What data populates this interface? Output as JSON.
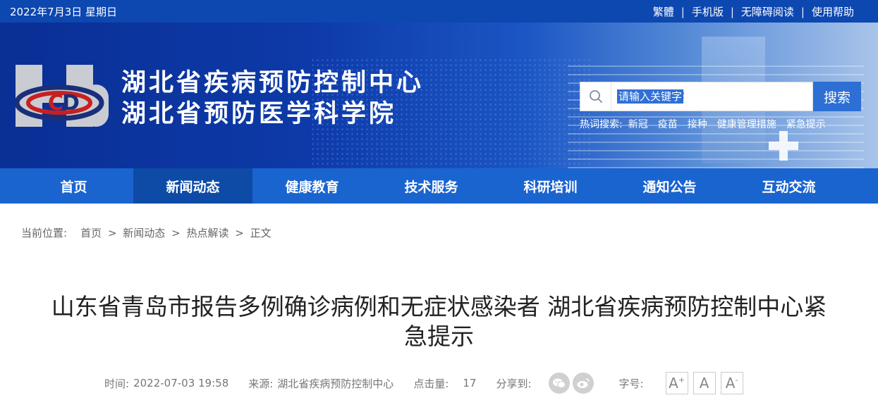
{
  "topbar": {
    "date": "2022年7月3日 星期日",
    "links": [
      "繁體",
      "手机版",
      "无障碍阅读",
      "使用帮助"
    ],
    "separator": "|"
  },
  "header": {
    "title_line1": "湖北省疾病预防控制中心",
    "title_line2": "湖北省预防医学科学院",
    "logo_icon": "hbcdc-logo"
  },
  "search": {
    "placeholder": "请输入关键字",
    "button": "搜索",
    "hot_label": "热词搜索:",
    "hot_words": [
      "新冠",
      "疫苗",
      "接种",
      "健康管理措施",
      "紧急提示"
    ]
  },
  "nav": {
    "items": [
      "首页",
      "新闻动态",
      "健康教育",
      "技术服务",
      "科研培训",
      "通知公告",
      "互动交流"
    ],
    "active_index": 1
  },
  "breadcrumb": {
    "label": "当前位置:",
    "items": [
      "首页",
      "新闻动态",
      "热点解读",
      "正文"
    ],
    "arrow": ">"
  },
  "article": {
    "title_line1": "山东省青岛市报告多例确诊病例和无症状感染者 湖北省疾病预防控制中心紧",
    "title_line2": "急提示",
    "time_label": "时间:",
    "time": "2022-07-03 19:58",
    "source_label": "来源:",
    "source": "湖北省疾病预防控制中心",
    "clicks_label": "点击量:",
    "clicks": "17",
    "share_label": "分享到:",
    "fontsize_label": "字号:",
    "fontsize_buttons": [
      "A",
      "A",
      "A"
    ],
    "fontsize_marks": [
      "+",
      "",
      "-"
    ]
  },
  "colors": {
    "topbar": "#0d47b0",
    "nav": "#1a64cf",
    "nav_active": "#0e4ba6",
    "search_button": "#2d6fd4"
  }
}
